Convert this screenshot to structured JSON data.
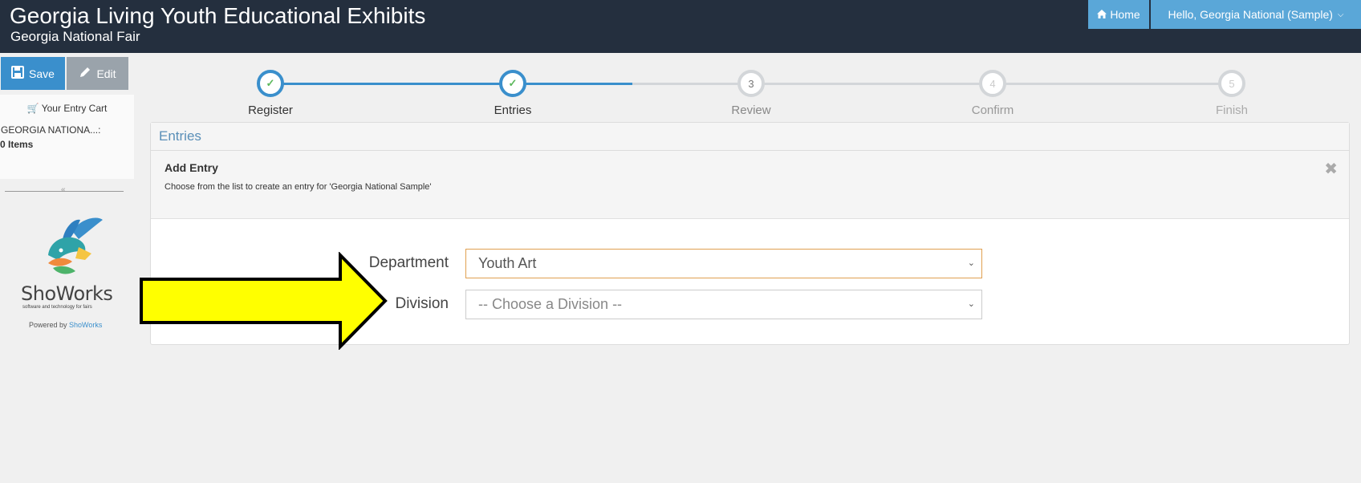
{
  "header": {
    "title": "Georgia Living Youth Educational Exhibits",
    "subtitle": "Georgia National Fair",
    "home_label": "Home",
    "user_label": "Hello, Georgia National (Sample)"
  },
  "sidebar": {
    "save_label": "Save",
    "edit_label": "Edit",
    "cart_title": "Your Entry Cart",
    "cart_name": "GEORGIA NATIONA...:",
    "cart_count": "0 Items",
    "logo_name": "ShoWorks",
    "logo_tagline": "software and technology for fairs",
    "powered_prefix": "Powered by",
    "powered_link": "ShoWorks"
  },
  "stepper": {
    "steps": [
      {
        "label": "Register",
        "state": "done"
      },
      {
        "label": "Entries",
        "state": "done"
      },
      {
        "label": "Review",
        "number": "3",
        "state": "todo"
      },
      {
        "label": "Confirm",
        "number": "4",
        "state": "todo"
      },
      {
        "label": "Finish",
        "number": "5",
        "state": "todo"
      }
    ]
  },
  "entries": {
    "title": "Entries",
    "add_entry_title": "Add Entry",
    "add_entry_desc": "Choose from the list to create an entry for 'Georgia National Sample'",
    "department_label": "Department",
    "department_value": "Youth Art",
    "division_label": "Division",
    "division_value": "-- Choose a Division --"
  },
  "colors": {
    "header_bg": "#242f3e",
    "accent": "#3a8fcc",
    "arrow_fill": "#ffff00"
  }
}
